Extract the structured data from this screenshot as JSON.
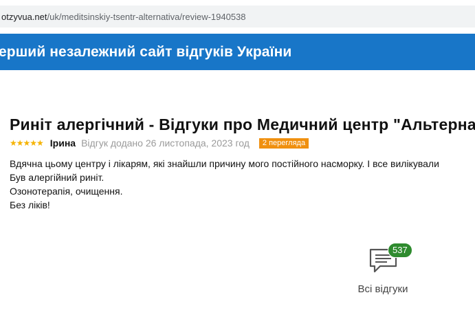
{
  "address_bar": {
    "url_domain": "otzyvua.net",
    "url_path": "/uk/meditsinskiy-tsentr-alternativa/review-1940538"
  },
  "banner": {
    "text": "ерший незалежний сайт відгуків України"
  },
  "review": {
    "title": "Риніт алергічний - Відгуки про Медичний центр \"Альтернатива\"",
    "rating": 5,
    "stars": "★★★★★",
    "author": "Ірина",
    "date": "Відгук додано 26 листопада, 2023 год",
    "views": "2 перегляда",
    "body": [
      "Вдячна цьому центру і лікарям, які знайшли причину мого постійного насморку. І все вилікували",
      "Був алергійний риніт.",
      "Озонотерапія, очищення.",
      "Без ліків!"
    ]
  },
  "all_reviews": {
    "count": "537",
    "label": "Всі відгуки",
    "icon": "chat-bubble-icon"
  },
  "colors": {
    "banner": "#1876c8",
    "stars": "#f5b301",
    "views_badge": "#f0900f",
    "count_badge": "#2e8b2e"
  }
}
